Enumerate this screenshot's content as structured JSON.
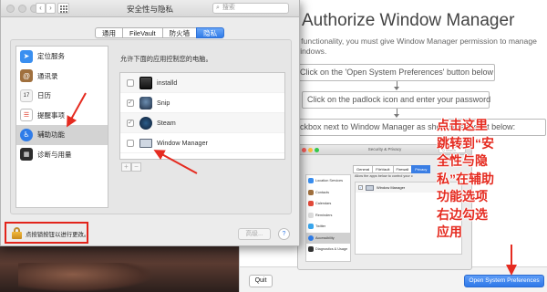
{
  "prefs": {
    "title": "安全性与隐私",
    "search_placeholder": "搜索",
    "tabs": [
      "通用",
      "FileVault",
      "防火墙",
      "隐私"
    ],
    "active_tab_index": 3,
    "sidebar": [
      {
        "label": "定位服务",
        "icon": "location-arrow-icon",
        "color": "#3a8ff0"
      },
      {
        "label": "通讯录",
        "icon": "contacts-book-icon",
        "color": "#a0703e"
      },
      {
        "label": "日历",
        "icon": "calendar-icon",
        "color": "#e4e4e4"
      },
      {
        "label": "提醒事项",
        "icon": "reminders-list-icon",
        "color": "#ffffff"
      },
      {
        "label": "辅助功能",
        "icon": "accessibility-icon",
        "color": "#2f7ce8",
        "selected": true
      },
      {
        "label": "诊断与用量",
        "icon": "diagnostics-chart-icon",
        "color": "#2d2d2d"
      }
    ],
    "hint": "允许下面的应用控制您的电脑。",
    "apps": [
      {
        "name": "installd",
        "checked": false,
        "icon": "installd-icon"
      },
      {
        "name": "Snip",
        "checked": true,
        "icon": "snip-icon"
      },
      {
        "name": "Steam",
        "checked": true,
        "icon": "steam-icon"
      },
      {
        "name": "Window Manager",
        "checked": false,
        "icon": "window-manager-icon"
      }
    ],
    "plus": "+",
    "minus": "−",
    "lock_text": "点按锁按钮以进行更改。",
    "advanced_label": "高级...",
    "help_label": "?"
  },
  "auth": {
    "title": "Authorize Window Manager",
    "desc": "o functionality, you must give Window Manager permission to manage windows.",
    "step1": "Click on the 'Open System Preferences' button below",
    "step2": "Click on the padlock icon and enter your password",
    "step3": "ckbox next to Window Manager as show   screenshot below:",
    "quit_label": "Quit",
    "open_label": "Open System Preferences"
  },
  "mini": {
    "title": "Security & Privacy",
    "search": "Q Search",
    "tabs": [
      "General",
      "FileVault",
      "Firewall",
      "Privacy"
    ],
    "sidebar": [
      "Location Services",
      "Contacts",
      "Calendars",
      "Reminders",
      "Twitter",
      "Accessibility",
      "Diagnostics & Usage"
    ],
    "hint": "Allow the apps below to control your c",
    "app": "Window Manager"
  },
  "annotation": {
    "lines": [
      "点击这里",
      "跳转到“安",
      "全性与隐",
      "私”在辅助",
      "功能选项",
      "右边勾选",
      "应用"
    ],
    "color": "#e52b20"
  }
}
